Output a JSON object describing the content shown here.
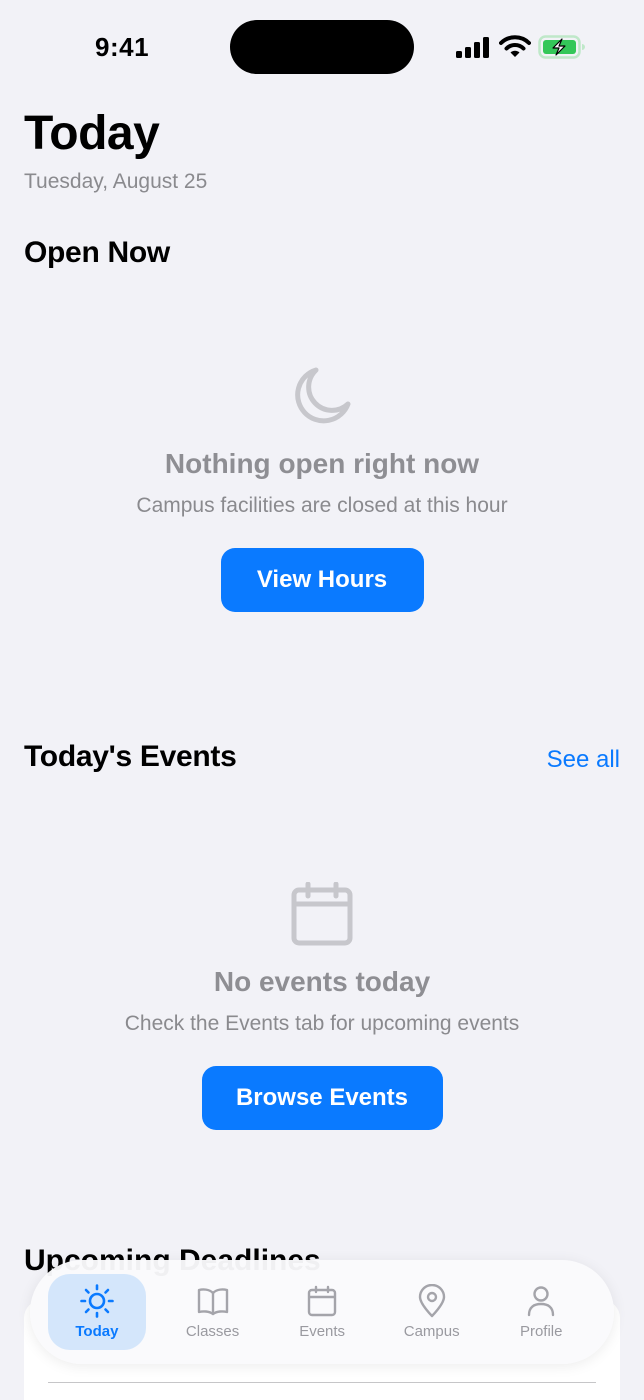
{
  "status_bar": {
    "time": "9:41"
  },
  "header": {
    "title": "Today",
    "date": "Tuesday, August 25"
  },
  "open_now": {
    "title": "Open Now",
    "empty": {
      "icon": "moon-icon",
      "title": "Nothing open right now",
      "subtitle": "Campus facilities are closed at this hour",
      "button": "View Hours"
    }
  },
  "events": {
    "title": "Today's Events",
    "see_all": "See all",
    "empty": {
      "icon": "calendar-icon",
      "title": "No events today",
      "subtitle": "Check the Events tab for upcoming events",
      "button": "Browse Events"
    }
  },
  "next_section": {
    "title": "Upcoming Deadlines"
  },
  "tab_bar": {
    "items": [
      {
        "label": "Today",
        "icon": "sun-icon",
        "active": true
      },
      {
        "label": "Classes",
        "icon": "book-icon",
        "active": false
      },
      {
        "label": "Events",
        "icon": "calendar-icon",
        "active": false
      },
      {
        "label": "Campus",
        "icon": "map-pin-icon",
        "active": false
      },
      {
        "label": "Profile",
        "icon": "person-icon",
        "active": false
      }
    ]
  },
  "colors": {
    "accent": "#0a7aff",
    "background": "#f2f2f7",
    "secondary_text": "#8a8a8e",
    "battery": "#34c759"
  }
}
